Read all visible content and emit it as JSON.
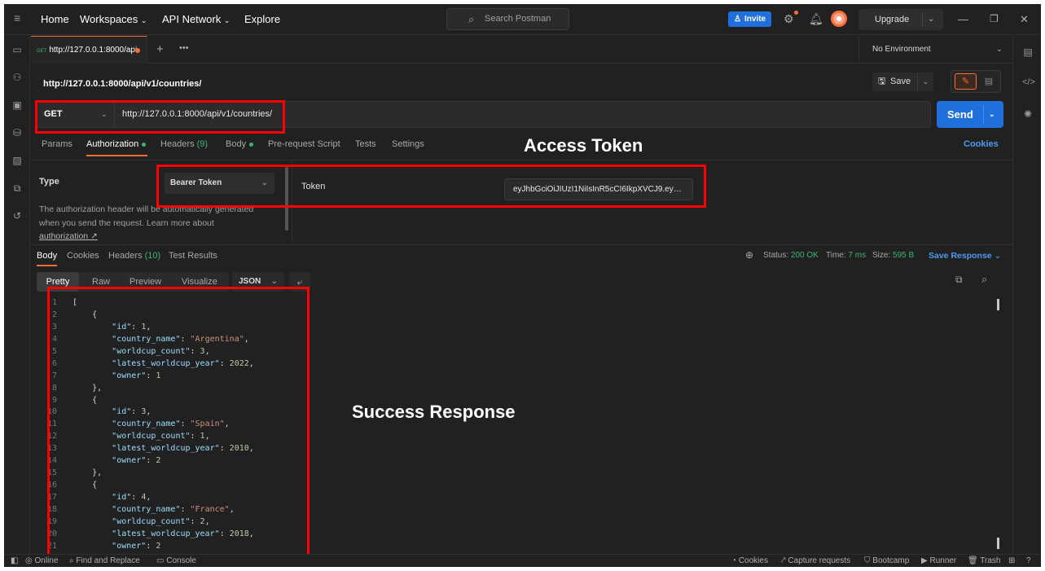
{
  "header": {
    "nav": [
      "Home",
      "Workspaces",
      "API Network",
      "Explore"
    ],
    "search_placeholder": "Search Postman",
    "invite_label": "Invite",
    "upgrade_label": "Upgrade"
  },
  "tabs": {
    "active_method": "GET",
    "active_title": "http://127.0.0.1:8000/api",
    "environment": "No Environment"
  },
  "request": {
    "title": "http://127.0.0.1:8000/api/v1/countries/",
    "save_label": "Save",
    "method": "GET",
    "url": "http://127.0.0.1:8000/api/v1/countries/",
    "send_label": "Send",
    "tabs": [
      {
        "label": "Params",
        "count": ""
      },
      {
        "label": "Authorization",
        "count": ""
      },
      {
        "label": "Headers",
        "count": "(9)"
      },
      {
        "label": "Body",
        "count": ""
      },
      {
        "label": "Pre-request Script",
        "count": ""
      },
      {
        "label": "Tests",
        "count": ""
      },
      {
        "label": "Settings",
        "count": ""
      }
    ],
    "cookies_label": "Cookies"
  },
  "auth": {
    "type_label": "Type",
    "type_value": "Bearer Token",
    "description": "The authorization header will be automatically generated when you send the request. Learn more about",
    "learn_link": "authorization ↗",
    "token_label": "Token",
    "token_value": "eyJhbGciOiJIUzI1NiIsInR5cCI6IkpXVCJ9.ey…"
  },
  "response": {
    "tabs": [
      {
        "label": "Body",
        "count": ""
      },
      {
        "label": "Cookies",
        "count": ""
      },
      {
        "label": "Headers",
        "count": "(10)"
      },
      {
        "label": "Test Results",
        "count": ""
      }
    ],
    "status_label": "Status:",
    "status_value": "200 OK",
    "time_label": "Time:",
    "time_value": "7 ms",
    "size_label": "Size:",
    "size_value": "595 B",
    "save_response": "Save Response",
    "formats": [
      "Pretty",
      "Raw",
      "Preview",
      "Visualize"
    ],
    "language": "JSON",
    "lines": [
      {
        "n": "1",
        "t": "["
      },
      {
        "n": "2",
        "t": "    {"
      },
      {
        "n": "3",
        "t": "        \"id\": 1,"
      },
      {
        "n": "4",
        "t": "        \"country_name\": \"Argentina\","
      },
      {
        "n": "5",
        "t": "        \"worldcup_count\": 3,"
      },
      {
        "n": "6",
        "t": "        \"latest_worldcup_year\": 2022,"
      },
      {
        "n": "7",
        "t": "        \"owner\": 1"
      },
      {
        "n": "8",
        "t": "    },"
      },
      {
        "n": "9",
        "t": "    {"
      },
      {
        "n": "10",
        "t": "        \"id\": 3,"
      },
      {
        "n": "11",
        "t": "        \"country_name\": \"Spain\","
      },
      {
        "n": "12",
        "t": "        \"worldcup_count\": 1,"
      },
      {
        "n": "13",
        "t": "        \"latest_worldcup_year\": 2010,"
      },
      {
        "n": "14",
        "t": "        \"owner\": 2"
      },
      {
        "n": "15",
        "t": "    },"
      },
      {
        "n": "16",
        "t": "    {"
      },
      {
        "n": "17",
        "t": "        \"id\": 4,"
      },
      {
        "n": "18",
        "t": "        \"country_name\": \"France\","
      },
      {
        "n": "19",
        "t": "        \"worldcup_count\": 2,"
      },
      {
        "n": "20",
        "t": "        \"latest_worldcup_year\": 2018,"
      },
      {
        "n": "21",
        "t": "        \"owner\": 2"
      }
    ]
  },
  "annotations": {
    "access_token": "Access Token",
    "success_response": "Success Response"
  },
  "statusbar": {
    "left": [
      "Online",
      "Find and Replace",
      "Console"
    ],
    "right": [
      "Cookies",
      "Capture requests",
      "Bootcamp",
      "Runner",
      "Trash"
    ]
  },
  "colors": {
    "accent": "#ff6c37",
    "primary_blue": "#1f6fdc",
    "success_green": "#3cb371",
    "annotation_red": "#ff0000"
  }
}
